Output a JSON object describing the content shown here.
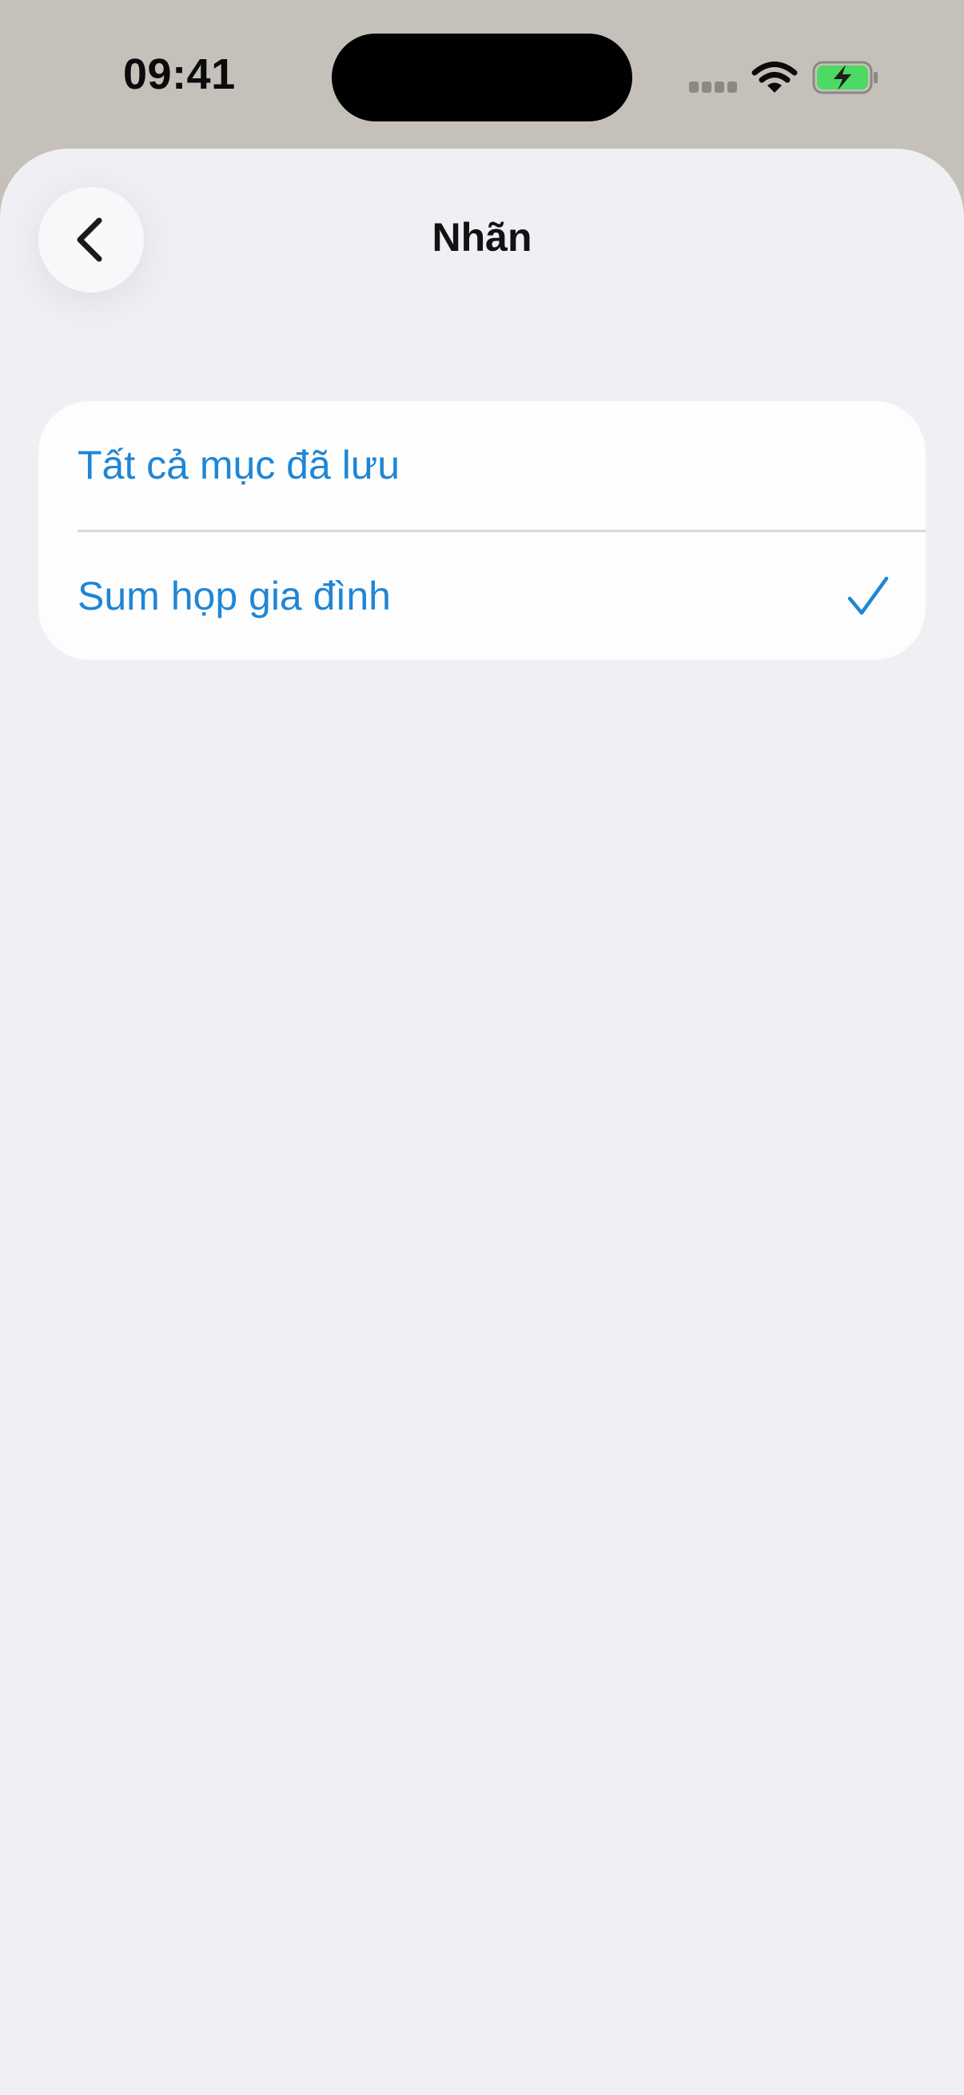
{
  "status_bar": {
    "time": "09:41"
  },
  "nav": {
    "title": "Nhãn",
    "back_icon": "chevron-left-icon"
  },
  "list": {
    "items": [
      {
        "label": "Tất cả mục đã lưu",
        "selected": false
      },
      {
        "label": "Sum họp gia đình",
        "selected": true
      }
    ]
  },
  "colors": {
    "accent": "#1f86d6",
    "sheet_background": "#efeff4",
    "card_background": "#fdfdfd",
    "battery_fill": "#4cd964"
  }
}
